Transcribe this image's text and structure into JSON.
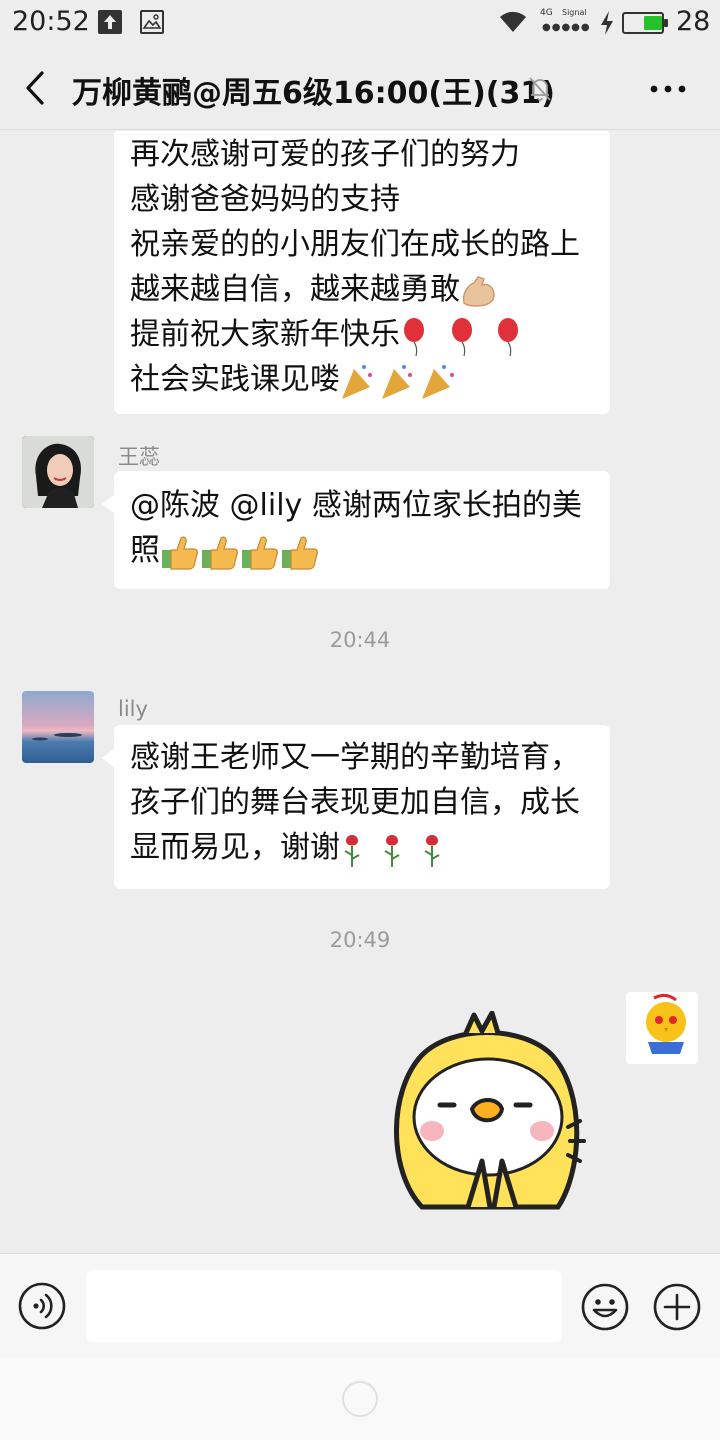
{
  "status_bar": {
    "time": "20:52",
    "network": "4G",
    "signal_label": "Signal",
    "battery_percent": "28",
    "battery_level": 0.28
  },
  "header": {
    "title": "万柳黄鹂@周五6级16:00(王)(31)"
  },
  "messages": [
    {
      "type": "text",
      "lines": [
        "再次感谢可爱的孩子们的努力",
        "感谢爸爸妈妈的支持",
        "祝亲爱的的小朋友们在成长的路上",
        "越来越自信，越来越勇敢",
        "提前祝大家新年快乐",
        "社会实践课见喽"
      ],
      "emojis": [
        "flexed-biceps",
        "balloon",
        "party-popper"
      ]
    },
    {
      "type": "text",
      "sender": "王蕊",
      "lines": [
        "@陈波  @lily  感谢两位家长拍的美",
        "照"
      ],
      "emojis": [
        "thumbs-up"
      ]
    },
    {
      "type": "timestamp",
      "text": "20:44"
    },
    {
      "type": "text",
      "sender": "lily",
      "lines": [
        "感谢王老师又一学期的辛勤培育，",
        "孩子们的舞台表现更加自信，成长",
        "显而易见，谢谢"
      ],
      "emojis": [
        "rose"
      ]
    },
    {
      "type": "timestamp",
      "text": "20:49"
    },
    {
      "type": "sticker",
      "sender": "self",
      "description_icon": "yellow-chick-sticker"
    }
  ],
  "input_bar": {
    "placeholder": "",
    "icons": [
      "voice-icon",
      "emoji-icon",
      "plus-icon"
    ]
  },
  "colors": {
    "background": "#ededed",
    "bubble": "#ffffff",
    "battery": "#27c22b"
  }
}
